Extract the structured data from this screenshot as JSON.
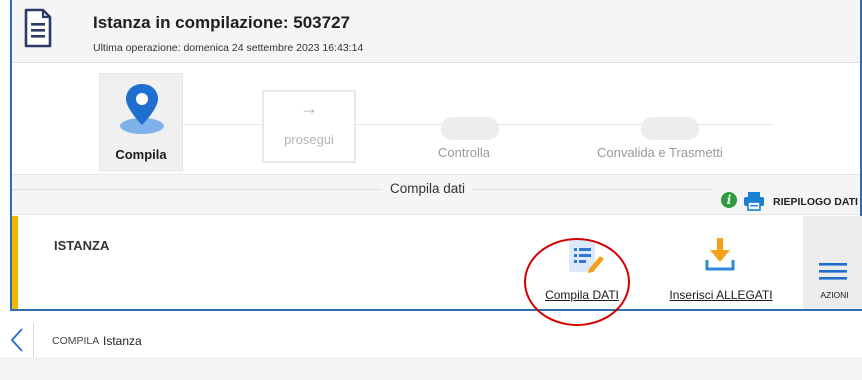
{
  "header": {
    "title": "Istanza in compilazione: 503727",
    "subtitle": "Ultima operazione: domenica 24 settembre 2023 16:43:14",
    "icon": "document-icon"
  },
  "steps": {
    "compila": {
      "label": "Compila",
      "icon": "map-pin-icon",
      "active": true
    },
    "prosegui": {
      "arrow": "→",
      "label": "prosegui"
    },
    "controlla": {
      "label": "Controlla"
    },
    "convalida": {
      "label": "Convalida e Trasmetti"
    }
  },
  "section_bar": {
    "label": "Compila dati",
    "info_glyph": "i",
    "riepilogo_label": "RIEPILOGO DATI"
  },
  "istanza": {
    "name": "ISTANZA",
    "actions": [
      {
        "label": "Compila DATI",
        "icon": "edit-form-icon"
      },
      {
        "label": "Inserisci ALLEGATI",
        "icon": "download-icon"
      }
    ],
    "azioni_label": "AZIONI"
  },
  "breadcrumb": {
    "items": [
      "COMPILA",
      "Istanza"
    ]
  },
  "colors": {
    "frame_border": "#2f6db5",
    "accent_yellow": "#f4b400",
    "pin_blue": "#1e6fcf",
    "info_green": "#2e9b3e",
    "printer_blue": "#1a7fd6",
    "download_orange": "#f5a21b",
    "highlight_red": "#d40000"
  }
}
